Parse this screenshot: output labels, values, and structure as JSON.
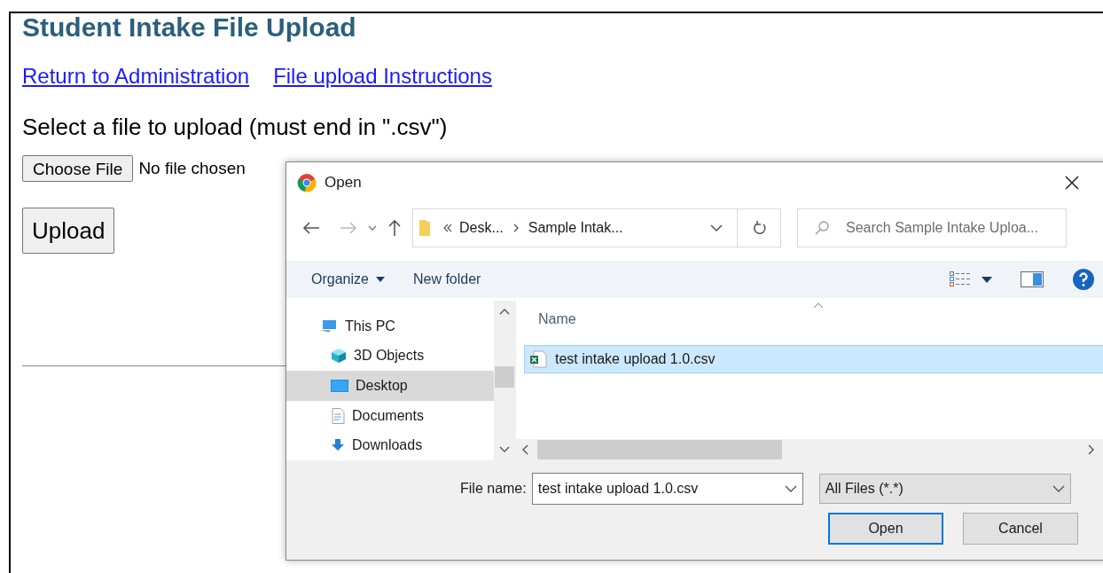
{
  "page": {
    "title": "Student Intake File Upload",
    "links": [
      "Return to Administration",
      "File upload Instructions"
    ],
    "prompt": "Select a file to upload (must end in \".csv\")",
    "choose_button": "Choose File",
    "file_status": "No file chosen",
    "upload_button": "Upload"
  },
  "dialog": {
    "title": "Open",
    "breadcrumb": [
      "Desk...",
      "Sample Intak..."
    ],
    "search": {
      "placeholder": "Search Sample Intake Uploa..."
    },
    "toolbar": [
      {
        "label": "Organize",
        "dropdown": true
      },
      {
        "label": "New folder",
        "dropdown": false
      }
    ],
    "nav_pane": [
      {
        "label": "This PC",
        "kind": "pc",
        "selected": false,
        "children": [
          {
            "label": "3D Objects",
            "kind": "cube",
            "selected": false
          },
          {
            "label": "Desktop",
            "kind": "desktop",
            "selected": true
          },
          {
            "label": "Documents",
            "kind": "document",
            "selected": false
          },
          {
            "label": "Downloads",
            "kind": "download",
            "selected": false
          }
        ]
      }
    ],
    "file_list": {
      "column": "Name",
      "files": [
        {
          "name": "test intake upload 1.0.csv",
          "selected": true
        }
      ]
    },
    "file_name": {
      "label": "File name:",
      "value": "test intake upload 1.0.csv"
    },
    "file_type": "All Files (*.*)",
    "buttons": [
      {
        "label": "Open",
        "default": true
      },
      {
        "label": "Cancel",
        "default": false
      }
    ]
  }
}
